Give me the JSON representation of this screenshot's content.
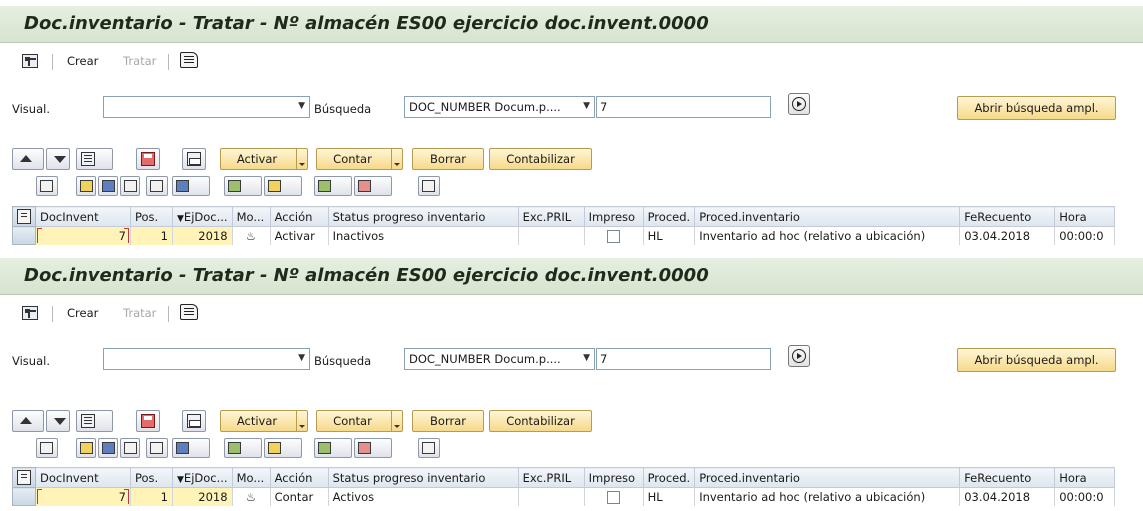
{
  "panels": [
    {
      "title": "Doc.inventario - Tratar - Nº almacén ES00 ejercicio doc.invent.0000",
      "menu": {
        "create": "Crear",
        "edit": "Tratar"
      },
      "search": {
        "visual_label": "Visual.",
        "visual_value": "",
        "busqueda_label": "Búsqueda",
        "busqueda_value": "DOC_NUMBER Docum.p....",
        "input_value": "7",
        "advanced_button": "Abrir búsqueda ampl."
      },
      "toolbar": {
        "activar": "Activar",
        "contar": "Contar",
        "borrar": "Borrar",
        "contabilizar": "Contabilizar"
      },
      "columns": [
        "DocInvent",
        "Pos.",
        "EjDoc...",
        "Mo...",
        "Acción",
        "Status progreso inventario",
        "Exc.PRIL",
        "Impreso",
        "Proced.",
        "Proced.inventario",
        "FeRecuento",
        "Hora"
      ],
      "row": {
        "docinvent": "7",
        "pos": "1",
        "ejdoc": "2018",
        "accion": "Activar",
        "status": "Inactivos",
        "excpril": "",
        "proced": "HL",
        "procedinv": "Inventario ad hoc (relativo a ubicación)",
        "ferecuento": "03.04.2018",
        "hora": "00:00:0"
      }
    },
    {
      "title": "Doc.inventario - Tratar - Nº almacén ES00 ejercicio doc.invent.0000",
      "menu": {
        "create": "Crear",
        "edit": "Tratar"
      },
      "search": {
        "visual_label": "Visual.",
        "visual_value": "",
        "busqueda_label": "Búsqueda",
        "busqueda_value": "DOC_NUMBER Docum.p....",
        "input_value": "7",
        "advanced_button": "Abrir búsqueda ampl."
      },
      "toolbar": {
        "activar": "Activar",
        "contar": "Contar",
        "borrar": "Borrar",
        "contabilizar": "Contabilizar"
      },
      "columns": [
        "DocInvent",
        "Pos.",
        "EjDoc...",
        "Mo...",
        "Acción",
        "Status progreso inventario",
        "Exc.PRIL",
        "Impreso",
        "Proced.",
        "Proced.inventario",
        "FeRecuento",
        "Hora"
      ],
      "row": {
        "docinvent": "7",
        "pos": "1",
        "ejdoc": "2018",
        "accion": "Contar",
        "status": "Activos",
        "excpril": "",
        "proced": "HL",
        "procedinv": "Inventario ad hoc (relativo a ubicación)",
        "ferecuento": "03.04.2018",
        "hora": "00:00:0"
      }
    }
  ],
  "colors": {
    "title_bg": "#d6e4cf",
    "button_yellow": "#f6d98a",
    "selected_cell": "#fff3b8",
    "input_border": "#8aa0b5"
  },
  "icons": [
    "command-field-icon",
    "scroll-edit-icon",
    "execute-icon",
    "move-up-icon",
    "move-down-icon",
    "layout-icon",
    "save-icon",
    "print-icon",
    "details-icon",
    "sort-ascending-icon",
    "filter-icon",
    "find-icon",
    "find-next-icon",
    "filter-set-icon",
    "sum-icon",
    "subtotal-icon",
    "export-icon",
    "layout-change-icon",
    "print-preview-icon",
    "mode-glasses-icon",
    "row-select-icon"
  ]
}
